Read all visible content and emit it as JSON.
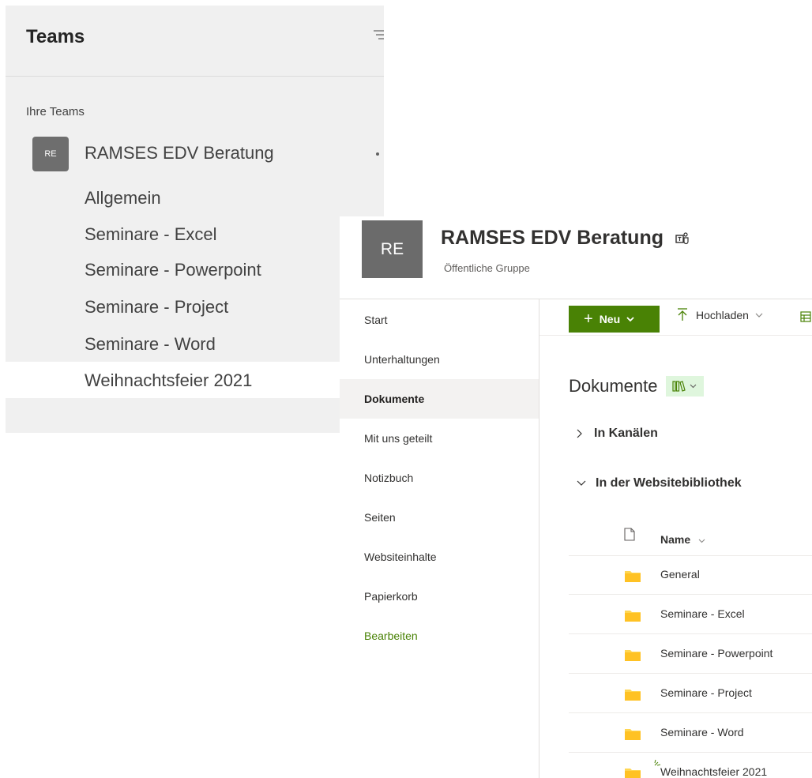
{
  "teams": {
    "title": "Teams",
    "your_teams_label": "Ihre Teams",
    "team": {
      "avatar": "RE",
      "name": "RAMSES EDV Beratung"
    },
    "channels": [
      {
        "label": "Allgemein"
      },
      {
        "label": "Seminare - Excel"
      },
      {
        "label": "Seminare - Powerpoint"
      },
      {
        "label": "Seminare - Project"
      },
      {
        "label": "Seminare - Word"
      },
      {
        "label": "Weihnachtsfeier 2021",
        "selected": true
      }
    ]
  },
  "sharepoint": {
    "logo": "RE",
    "site_title": "RAMSES EDV Beratung",
    "site_subtitle": "Öffentliche Gruppe",
    "nav": [
      {
        "label": "Start"
      },
      {
        "label": "Unterhaltungen"
      },
      {
        "label": "Dokumente",
        "active": true
      },
      {
        "label": "Mit uns geteilt"
      },
      {
        "label": "Notizbuch"
      },
      {
        "label": "Seiten"
      },
      {
        "label": "Websiteinhalte"
      },
      {
        "label": "Papierkorb"
      },
      {
        "label": "Bearbeiten",
        "edit": true
      }
    ],
    "commands": {
      "new_label": "Neu",
      "upload_label": "Hochladen"
    },
    "library_title": "Dokumente",
    "sections": {
      "channels": "In Kanälen",
      "site_library": "In der Websitebibliothek"
    },
    "list": {
      "name_header": "Name",
      "files": [
        {
          "name": "General"
        },
        {
          "name": "Seminare - Excel"
        },
        {
          "name": "Seminare - Powerpoint"
        },
        {
          "name": "Seminare - Project"
        },
        {
          "name": "Seminare - Word"
        },
        {
          "name": "Weihnachtsfeier 2021",
          "is_new": true
        }
      ]
    },
    "colors": {
      "accent": "#498205",
      "folder": "#ffd652",
      "view_switch_bg": "#dff6dd"
    }
  }
}
